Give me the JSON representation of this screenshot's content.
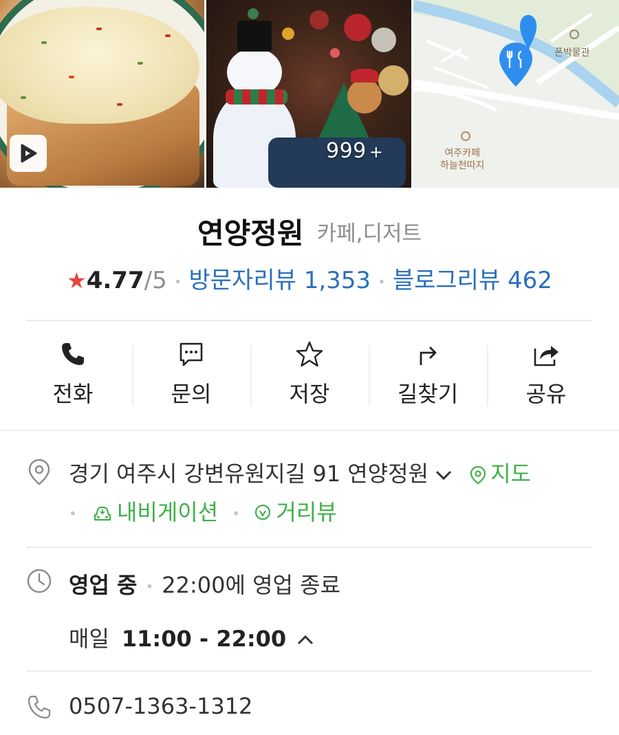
{
  "gallery": {
    "extra_photos_count": "999",
    "extra_photos_plus": "+",
    "play_icon": "play-icon",
    "map": {
      "label_museum": "폰박물관",
      "label_cafe_line1": "여주카페",
      "label_cafe_line2": "하늘천따지",
      "pin_icon": "restaurant-pin-icon",
      "accent_color": "#2e8ef0"
    }
  },
  "place": {
    "name": "연양정원",
    "category": "카페,디저트",
    "rating_star": "★",
    "rating": "4.77",
    "rating_max": "/5",
    "visitor_reviews": "방문자리뷰 1,353",
    "blog_reviews": "블로그리뷰 462"
  },
  "actions": [
    {
      "label": "전화",
      "icon": "phone-icon"
    },
    {
      "label": "문의",
      "icon": "chat-icon"
    },
    {
      "label": "저장",
      "icon": "star-icon"
    },
    {
      "label": "길찾기",
      "icon": "directions-icon"
    },
    {
      "label": "공유",
      "icon": "share-icon"
    }
  ],
  "address": {
    "text": "경기 여주시 강변유원지길 91 연양정원",
    "map_link": "지도",
    "navigation_link": "내비게이션",
    "street_view_link": "거리뷰",
    "link_color": "#3fb14a"
  },
  "hours": {
    "status": "영업 중",
    "closing_note": "22:00에 영업 종료",
    "days": "매일",
    "time_range": "11:00 - 22:00"
  },
  "phone": {
    "number": "0507-1363-1312"
  }
}
